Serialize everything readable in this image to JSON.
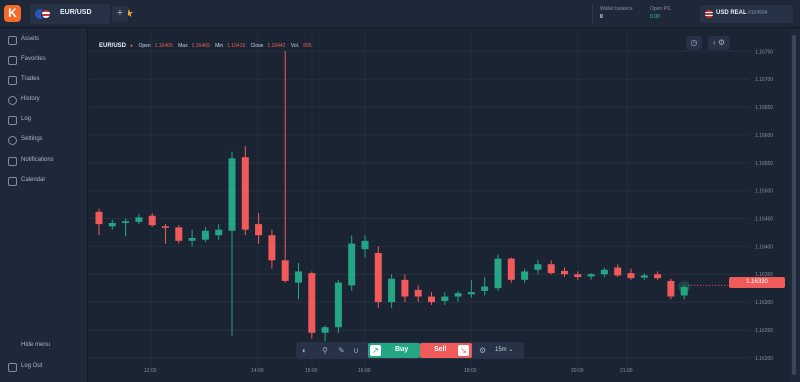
{
  "header": {
    "logo": "K",
    "asset_tab": "EUR/USD",
    "add_tab": "+",
    "wallet_label": "Wallet balance",
    "wallet_value": "0",
    "pl_label": "Open P/L",
    "pl_value": "0.00",
    "account_currency": "USD REAL",
    "account_id": "#104904"
  },
  "sidebar": {
    "items": [
      {
        "label": "Assets",
        "icon": "assets-icon"
      },
      {
        "label": "Favorites",
        "icon": "star-icon"
      },
      {
        "label": "Trades",
        "icon": "trades-icon"
      },
      {
        "label": "History",
        "icon": "history-icon"
      },
      {
        "label": "Log",
        "icon": "log-icon"
      },
      {
        "label": "Settings",
        "icon": "gear-icon"
      },
      {
        "label": "Notifications",
        "icon": "bell-icon"
      },
      {
        "label": "Calendar",
        "icon": "calendar-icon"
      }
    ],
    "hide_menu": "Hide menu",
    "logout": "Log Out"
  },
  "ohlc": {
    "symbol": "EUR/USD",
    "open_label": "Open",
    "open": "1.16465",
    "max_label": "Max",
    "max": "1.16469",
    "min_label": "Min",
    "min": "1.16419",
    "close_label": "Close",
    "close": "1.16442",
    "vol_label": "Vol.",
    "vol": "895"
  },
  "toolbar": {
    "buy": "Buy",
    "sell": "Sell",
    "timeframe": "15m"
  },
  "current_price": "1.16330",
  "colors": {
    "up": "#24a685",
    "down": "#f05a5a",
    "accent": "#f26b2a"
  },
  "chart_data": {
    "type": "candlestick",
    "y_ticks": [
      "1.16750",
      "1.16700",
      "1.16650",
      "1.16600",
      "1.16550",
      "1.16500",
      "1.16450",
      "1.16400",
      "1.16350",
      "1.16300",
      "1.16250",
      "1.16200"
    ],
    "x_ticks": [
      "12:00",
      "14:00",
      "15:00",
      "16:00",
      "18:00",
      "20:00",
      "21:00"
    ],
    "ylim": [
      1.1618,
      1.1679
    ],
    "candles": [
      {
        "o": 1.16462,
        "h": 1.16468,
        "l": 1.1642,
        "c": 1.1644
      },
      {
        "o": 1.16436,
        "h": 1.16448,
        "l": 1.1643,
        "c": 1.16442
      },
      {
        "o": 1.16442,
        "h": 1.1645,
        "l": 1.16418,
        "c": 1.16445
      },
      {
        "o": 1.16444,
        "h": 1.16458,
        "l": 1.1644,
        "c": 1.16452
      },
      {
        "o": 1.16455,
        "h": 1.1646,
        "l": 1.16435,
        "c": 1.16438
      },
      {
        "o": 1.16436,
        "h": 1.1644,
        "l": 1.16405,
        "c": 1.16435
      },
      {
        "o": 1.16434,
        "h": 1.16438,
        "l": 1.16405,
        "c": 1.1641
      },
      {
        "o": 1.1641,
        "h": 1.1643,
        "l": 1.164,
        "c": 1.16415
      },
      {
        "o": 1.16412,
        "h": 1.16435,
        "l": 1.16408,
        "c": 1.16428
      },
      {
        "o": 1.1642,
        "h": 1.1644,
        "l": 1.16412,
        "c": 1.1643
      },
      {
        "o": 1.16428,
        "h": 1.1657,
        "l": 1.1624,
        "c": 1.16558
      },
      {
        "o": 1.1656,
        "h": 1.1658,
        "l": 1.1642,
        "c": 1.1643
      },
      {
        "o": 1.1644,
        "h": 1.1646,
        "l": 1.16405,
        "c": 1.1642
      },
      {
        "o": 1.1642,
        "h": 1.1643,
        "l": 1.1636,
        "c": 1.16375
      },
      {
        "o": 1.16375,
        "h": 1.1675,
        "l": 1.16335,
        "c": 1.16338
      },
      {
        "o": 1.16335,
        "h": 1.1637,
        "l": 1.16305,
        "c": 1.16355
      },
      {
        "o": 1.16352,
        "h": 1.16355,
        "l": 1.16235,
        "c": 1.16245
      },
      {
        "o": 1.16245,
        "h": 1.16258,
        "l": 1.1623,
        "c": 1.16255
      },
      {
        "o": 1.16255,
        "h": 1.1634,
        "l": 1.16245,
        "c": 1.16335
      },
      {
        "o": 1.1633,
        "h": 1.1642,
        "l": 1.1632,
        "c": 1.16405
      },
      {
        "o": 1.16395,
        "h": 1.1642,
        "l": 1.1638,
        "c": 1.1641
      },
      {
        "o": 1.16388,
        "h": 1.164,
        "l": 1.1629,
        "c": 1.163
      },
      {
        "o": 1.163,
        "h": 1.1635,
        "l": 1.1629,
        "c": 1.16342
      },
      {
        "o": 1.1634,
        "h": 1.1635,
        "l": 1.163,
        "c": 1.1631
      },
      {
        "o": 1.16322,
        "h": 1.1633,
        "l": 1.163,
        "c": 1.1631
      },
      {
        "o": 1.1631,
        "h": 1.16318,
        "l": 1.16295,
        "c": 1.163
      },
      {
        "o": 1.16302,
        "h": 1.16318,
        "l": 1.16295,
        "c": 1.1631
      },
      {
        "o": 1.1631,
        "h": 1.1632,
        "l": 1.163,
        "c": 1.16316
      },
      {
        "o": 1.16314,
        "h": 1.1634,
        "l": 1.16308,
        "c": 1.16318
      },
      {
        "o": 1.1632,
        "h": 1.16345,
        "l": 1.16312,
        "c": 1.16328
      },
      {
        "o": 1.16325,
        "h": 1.16385,
        "l": 1.1632,
        "c": 1.16378
      },
      {
        "o": 1.16378,
        "h": 1.1638,
        "l": 1.16335,
        "c": 1.1634
      },
      {
        "o": 1.1634,
        "h": 1.1636,
        "l": 1.16335,
        "c": 1.16355
      },
      {
        "o": 1.16358,
        "h": 1.16376,
        "l": 1.1635,
        "c": 1.16368
      },
      {
        "o": 1.16368,
        "h": 1.16375,
        "l": 1.1635,
        "c": 1.16352
      },
      {
        "o": 1.16356,
        "h": 1.16362,
        "l": 1.16345,
        "c": 1.1635
      },
      {
        "o": 1.1635,
        "h": 1.16355,
        "l": 1.1634,
        "c": 1.16345
      },
      {
        "o": 1.16346,
        "h": 1.16352,
        "l": 1.1634,
        "c": 1.1635
      },
      {
        "o": 1.1635,
        "h": 1.16362,
        "l": 1.16345,
        "c": 1.16358
      },
      {
        "o": 1.16362,
        "h": 1.16368,
        "l": 1.16345,
        "c": 1.16348
      },
      {
        "o": 1.16352,
        "h": 1.1636,
        "l": 1.1634,
        "c": 1.16343
      },
      {
        "o": 1.16344,
        "h": 1.16352,
        "l": 1.1634,
        "c": 1.16348
      },
      {
        "o": 1.1635,
        "h": 1.16355,
        "l": 1.1634,
        "c": 1.16343
      },
      {
        "o": 1.16338,
        "h": 1.16342,
        "l": 1.16305,
        "c": 1.1631
      },
      {
        "o": 1.16312,
        "h": 1.1633,
        "l": 1.16305,
        "c": 1.16327
      }
    ]
  }
}
